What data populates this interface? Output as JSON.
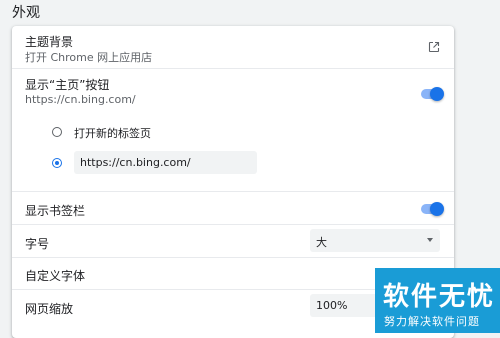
{
  "section_title": "外观",
  "theme": {
    "label": "主题背景",
    "sublabel": "打开 Chrome 网上应用店",
    "icon": "external-link-icon"
  },
  "home_button": {
    "label": "显示“主页”按钮",
    "sublabel": "https://cn.bing.com/",
    "enabled": true,
    "options": [
      {
        "label": "打开新的标签页",
        "checked": false
      },
      {
        "value": "https://cn.bing.com/",
        "checked": true
      }
    ]
  },
  "bookmarks_bar": {
    "label": "显示书签栏",
    "enabled": true
  },
  "font_size": {
    "label": "字号",
    "value": "大"
  },
  "custom_fonts": {
    "label": "自定义字体"
  },
  "page_zoom": {
    "label": "网页缩放",
    "value": "100%"
  },
  "watermark": {
    "title": "软件无忧",
    "subtitle": "努力解决软件问题"
  },
  "colors": {
    "accent": "#1a73e8",
    "toggle_track": "#8ab4f8",
    "background": "#f1f3f4",
    "watermark": "#1a9cd6"
  }
}
